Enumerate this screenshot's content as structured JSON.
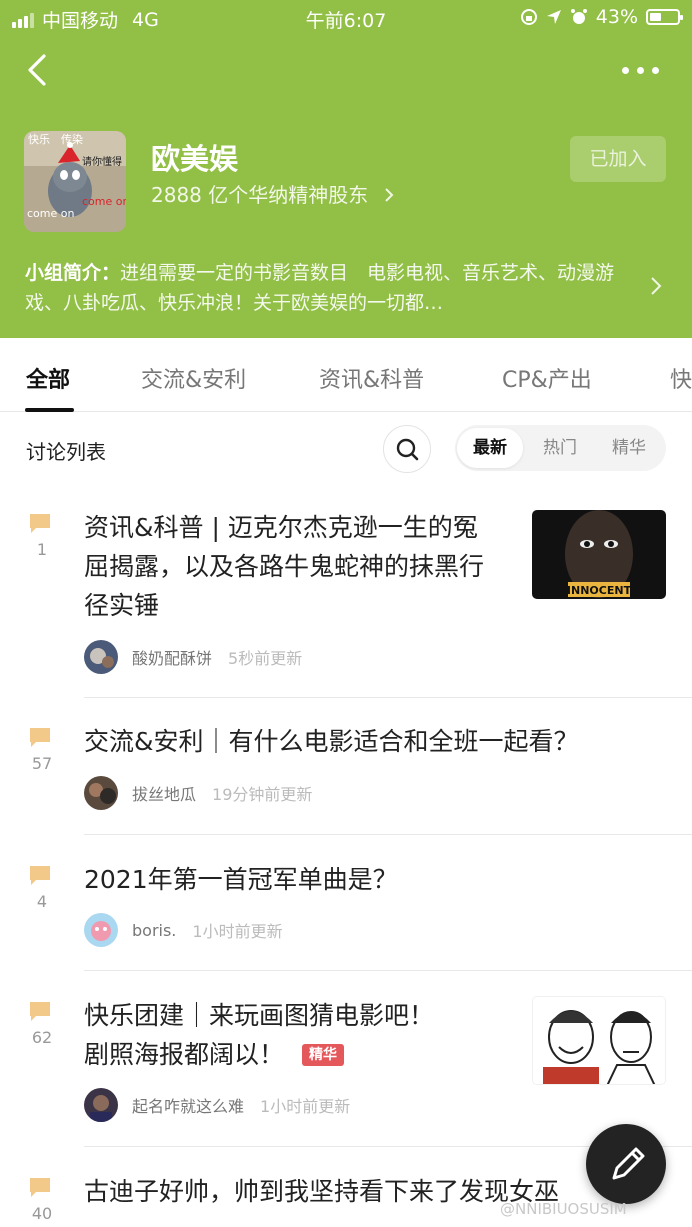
{
  "status_bar": {
    "carrier": "中国移动",
    "network": "4G",
    "time": "午前6:07",
    "battery": "43%",
    "battery_level": 0.43
  },
  "group": {
    "name": "欧美娱",
    "members": "2888 亿个华纳精神股东",
    "join_status": "已加入",
    "intro_label": "小组简介：",
    "intro_text": "进组需要一定的书影音数目　电影电视、音乐艺术、动漫游戏、八卦吃瓜、快乐冲浪！关于欧美娱的一切都…",
    "avatar_caption_top": "快乐　传染",
    "avatar_caption_side": "请你懂得",
    "avatar_caption_bottom": "come on",
    "avatar_caption_red": "come on"
  },
  "tabs": [
    {
      "label": "全部"
    },
    {
      "label": "交流&安利"
    },
    {
      "label": "资讯&科普"
    },
    {
      "label": "CP&产出"
    },
    {
      "label": "快"
    }
  ],
  "list": {
    "title": "讨论列表",
    "sort": [
      {
        "label": "最新"
      },
      {
        "label": "热门"
      },
      {
        "label": "精华"
      }
    ]
  },
  "posts": [
    {
      "replies": "1",
      "title_lines": [
        "资讯&科普 | 迈克尔杰克逊一生的冤",
        "屈揭露，以及各路牛鬼蛇神的抹黑行",
        "径实锤"
      ],
      "user": "酸奶配酥饼",
      "updated": "5秒前更新",
      "thumb_text": "INNOCENT"
    },
    {
      "replies": "57",
      "title_lines": [
        "交流&安利｜有什么电影适合和全班一起看？"
      ],
      "user": "拔丝地瓜",
      "updated": "19分钟前更新"
    },
    {
      "replies": "4",
      "title_lines": [
        "2021年第一首冠军单曲是？"
      ],
      "user": "boris.",
      "updated": "1小时前更新"
    },
    {
      "replies": "62",
      "title_lines": [
        "快乐团建｜来玩画图猜电影吧！",
        "剧照海报都阔以！"
      ],
      "tag": "精华",
      "user": "起名咋就这么难",
      "updated": "1小时前更新"
    },
    {
      "replies": "40",
      "title_lines": [
        "古迪子好帅，帅到我坚持看下来了发现女巫"
      ]
    }
  ],
  "watermark": "@NNIBIUOSUSIM",
  "colors": {
    "header_green": "#92bf46",
    "comment_icon": "#f3c98a",
    "tag_red": "#e4575b"
  },
  "icons": {
    "back": "chevron-left-icon",
    "more": "more-dots-icon",
    "search": "search-icon",
    "compose": "pencil-icon",
    "comment": "comment-bubble-icon"
  }
}
